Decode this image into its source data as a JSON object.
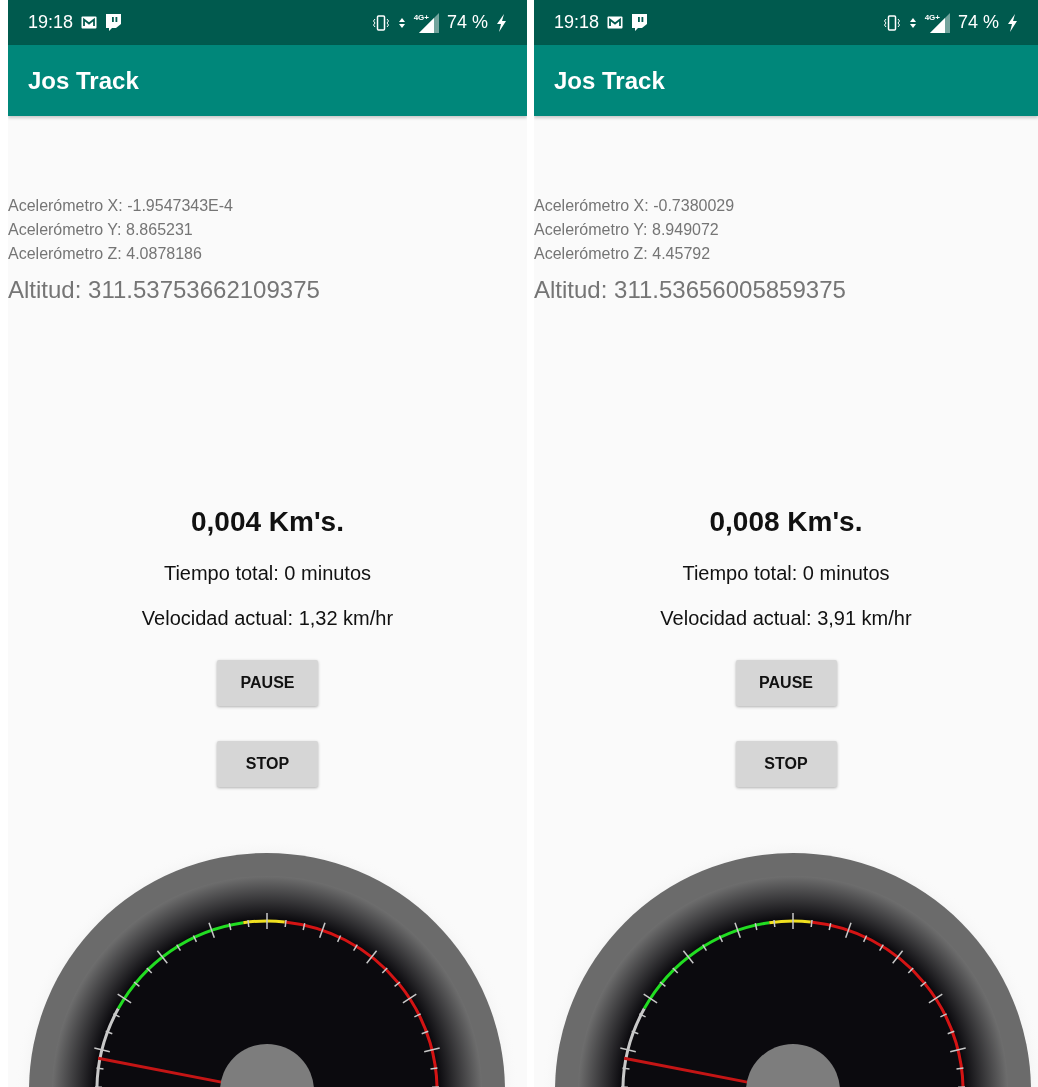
{
  "panels": [
    {
      "status_bar": {
        "time": "19:18",
        "network": "4G+",
        "battery": "74 %"
      },
      "app_bar": {
        "title": "Jos Track"
      },
      "sensors": [
        "Acelerómetro X: -1.9547343E-4",
        "Acelerómetro Y: 8.865231",
        "Acelerómetro Z: 4.0878186"
      ],
      "altitude": "Altitud: 311.53753662109375",
      "distance": "0,004 Km's.",
      "total_time": "Tiempo total: 0 minutos",
      "speed": "Velocidad actual: 1,32 km/hr",
      "buttons": [
        "PAUSE",
        "STOP"
      ]
    },
    {
      "status_bar": {
        "time": "19:18",
        "network": "4G+",
        "battery": "74 %"
      },
      "app_bar": {
        "title": "Jos Track"
      },
      "sensors": [
        "Acelerómetro X: -0.7380029",
        "Acelerómetro Y: 8.949072",
        "Acelerómetro Z: 4.45792"
      ],
      "altitude": "Altitud: 311.53656005859375",
      "distance": "0,008 Km's.",
      "total_time": "Tiempo total: 0 minutos",
      "speed": "Velocidad actual: 3,91 km/hr",
      "buttons": [
        "PAUSE",
        "STOP"
      ]
    }
  ]
}
